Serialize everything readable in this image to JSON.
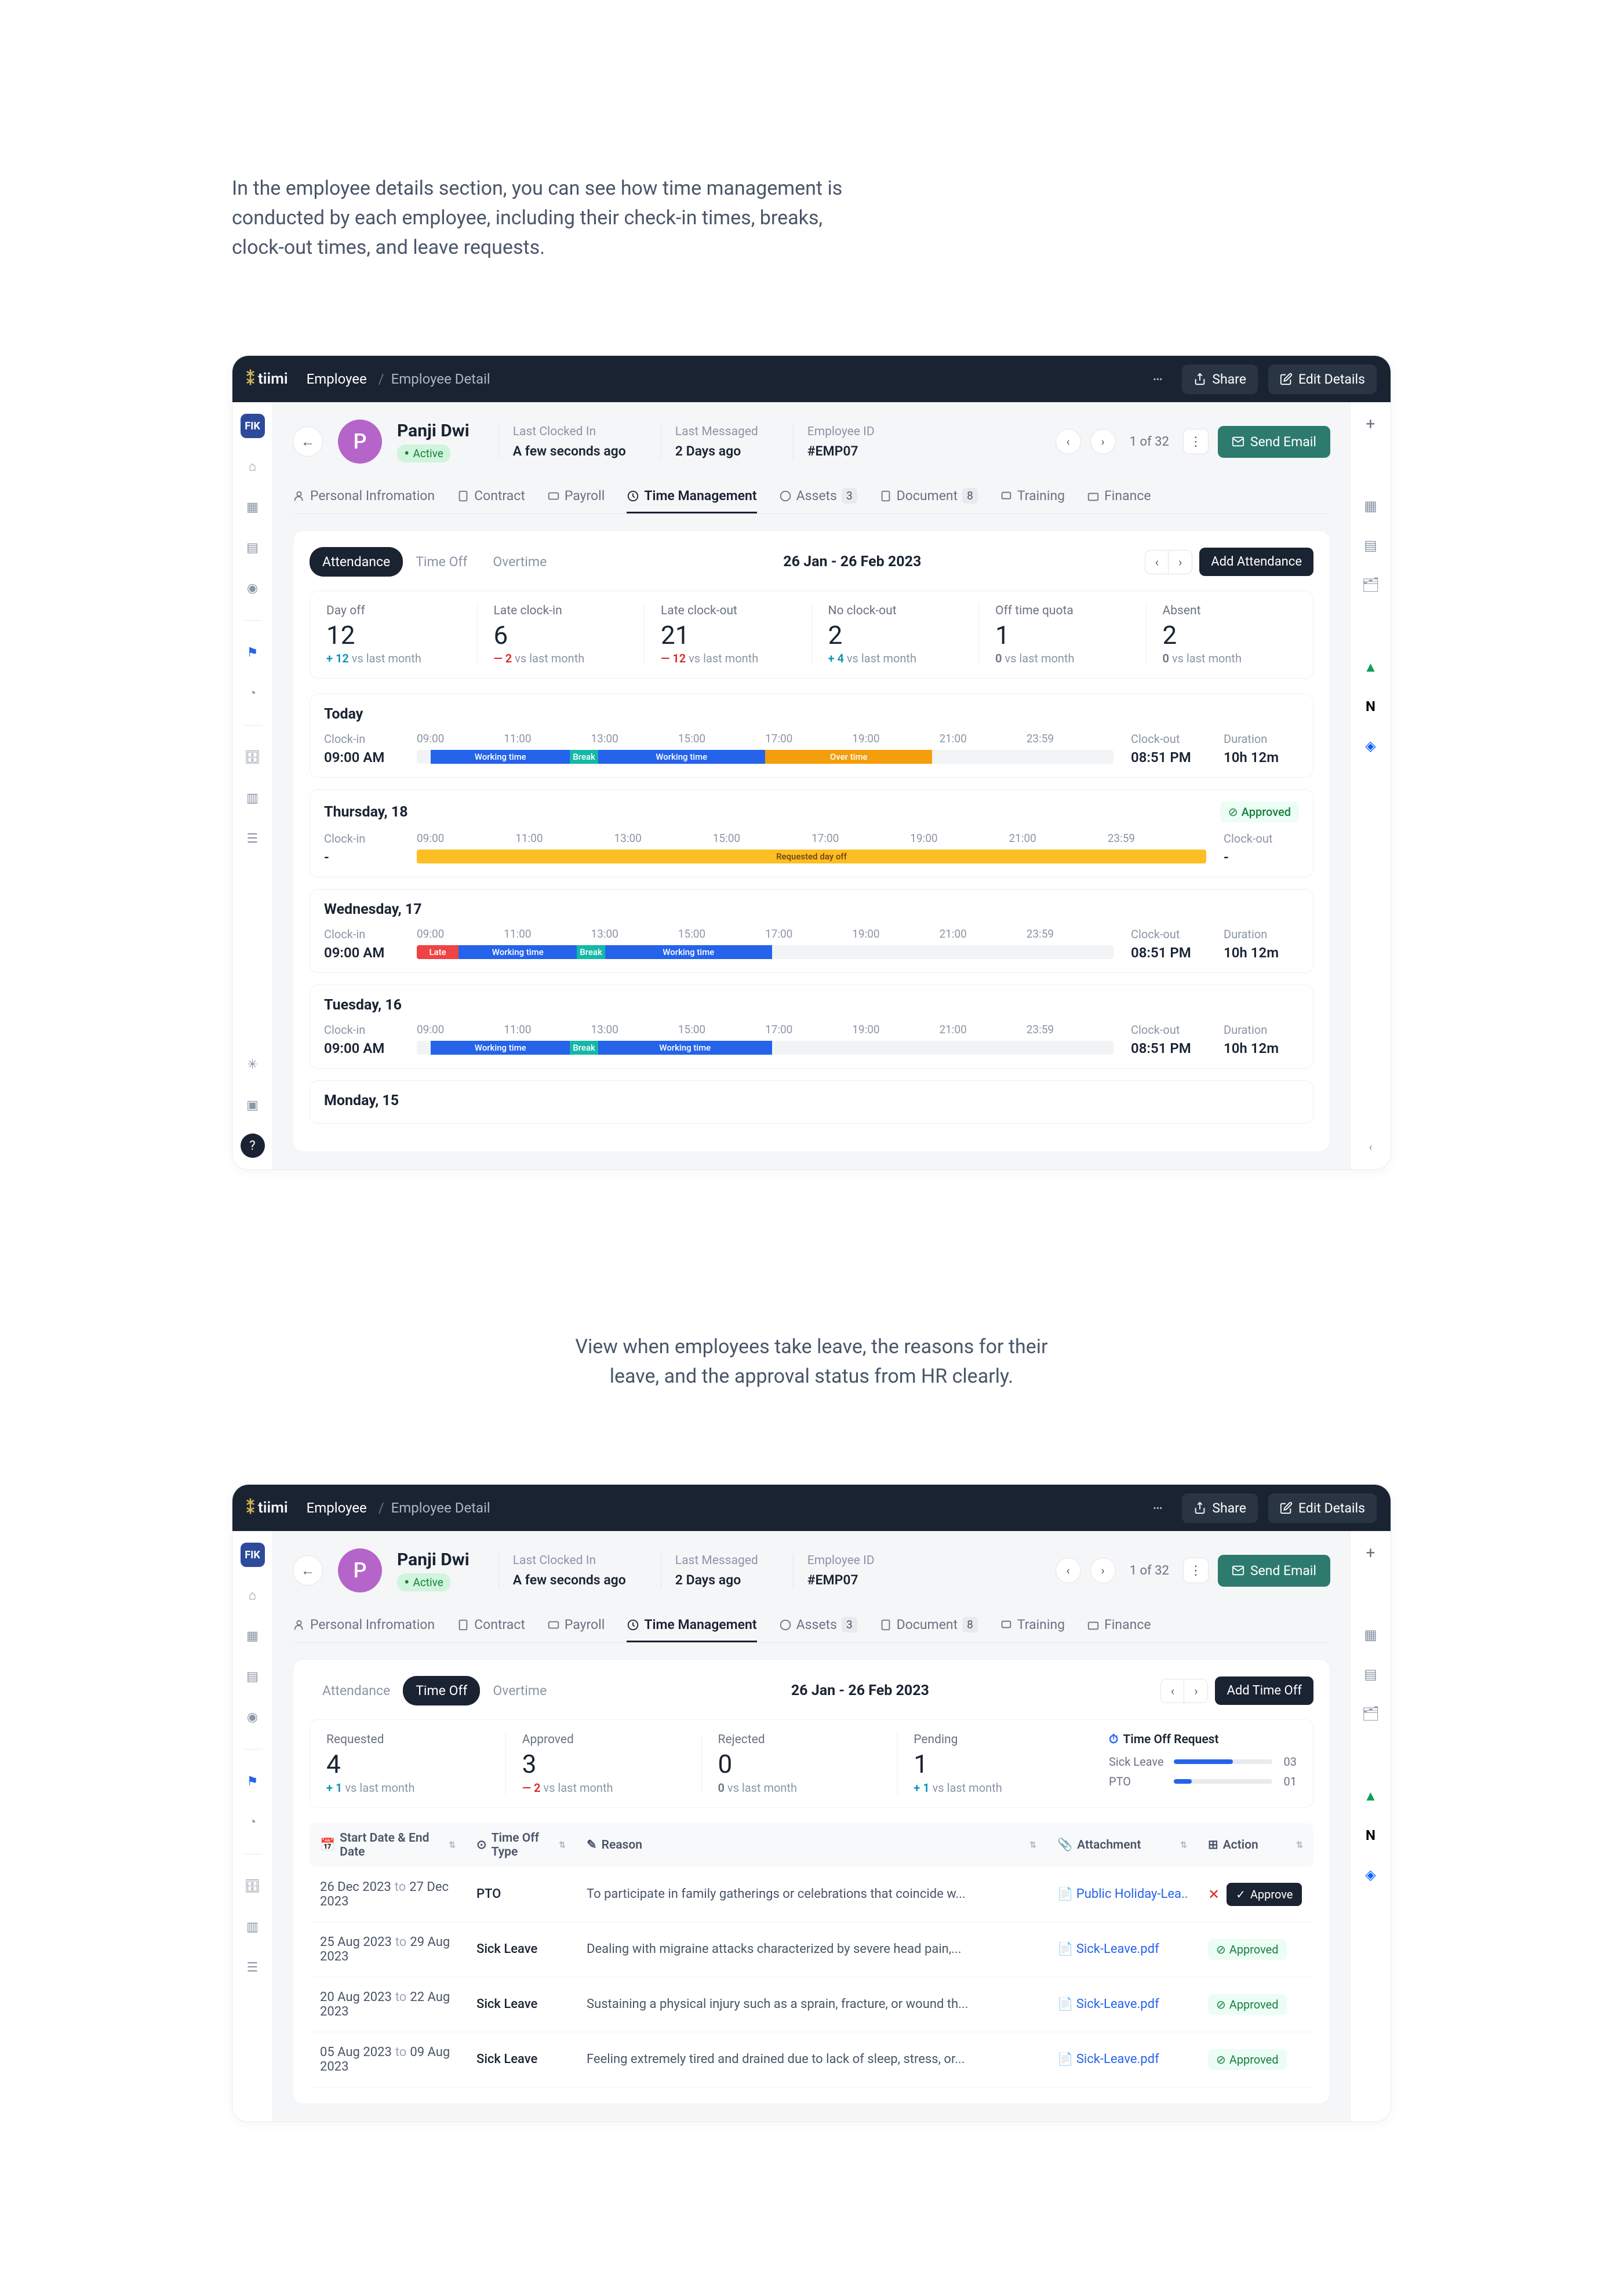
{
  "intro1": "In the employee details section, you can see how time management is conducted by each employee, including their check-in times, breaks, clock-out times, and leave requests.",
  "intro2": "View when employees take leave, the reasons for their leave, and the approval status from HR clearly.",
  "logo": "tiimi",
  "breadcrumb": {
    "a": "Employee",
    "b": "Employee Detail"
  },
  "topActions": {
    "share": "Share",
    "edit": "Edit Details"
  },
  "employee": {
    "initial": "P",
    "name": "Panji Dwi",
    "status": "Active",
    "meta": [
      {
        "label": "Last Clocked In",
        "value": "A few seconds ago"
      },
      {
        "label": "Last Messaged",
        "value": "2 Days ago"
      },
      {
        "label": "Employee ID",
        "value": "#EMP07"
      }
    ],
    "page": "1 of 32",
    "send": "Send Email"
  },
  "tabs": [
    {
      "label": "Personal Infromation"
    },
    {
      "label": "Contract"
    },
    {
      "label": "Payroll"
    },
    {
      "label": "Time Management",
      "active": true
    },
    {
      "label": "Assets",
      "count": "3"
    },
    {
      "label": "Document",
      "count": "8"
    },
    {
      "label": "Training"
    },
    {
      "label": "Finance"
    }
  ],
  "dateRange": "26 Jan - 26 Feb 2023",
  "attendance": {
    "pills": [
      "Attendance",
      "Time Off",
      "Overtime"
    ],
    "addBtn": "Add Attendance",
    "stats": [
      {
        "label": "Day off",
        "value": "12",
        "delta": "+ 12",
        "dir": "up",
        "suffix": " vs last month"
      },
      {
        "label": "Late clock-in",
        "value": "6",
        "delta": "— 2",
        "dir": "down",
        "suffix": " vs last month"
      },
      {
        "label": "Late clock-out",
        "value": "21",
        "delta": "— 12",
        "dir": "down",
        "suffix": " vs last month"
      },
      {
        "label": "No clock-out",
        "value": "2",
        "delta": "+ 4",
        "dir": "up",
        "suffix": " vs last month"
      },
      {
        "label": "Off time quota",
        "value": "1",
        "delta": "0",
        "dir": "neutral",
        "suffix": " vs last month"
      },
      {
        "label": "Absent",
        "value": "2",
        "delta": "0",
        "dir": "neutral",
        "suffix": " vs last month"
      }
    ],
    "hours": [
      "09:00",
      "11:00",
      "13:00",
      "15:00",
      "17:00",
      "19:00",
      "21:00",
      "23:59"
    ],
    "labels": {
      "clockin": "Clock-in",
      "clockout": "Clock-out",
      "duration": "Duration",
      "working": "Working time",
      "break": "Break",
      "overtime": "Over time",
      "late": "Late",
      "reqoff": "Requested day off",
      "approved": "Approved"
    },
    "days": [
      {
        "title": "Today",
        "clockin": "09:00 AM",
        "clockout": "08:51 PM",
        "duration": "10h 12m"
      },
      {
        "title": "Thursday, 18",
        "clockin": "-",
        "clockout": "-",
        "approved": true
      },
      {
        "title": "Wednesday, 17",
        "clockin": "09:00 AM",
        "clockout": "08:51 PM",
        "duration": "10h 12m"
      },
      {
        "title": "Tuesday, 16",
        "clockin": "09:00 AM",
        "clockout": "08:51 PM",
        "duration": "10h 12m"
      },
      {
        "title": "Monday, 15"
      }
    ]
  },
  "timeoff": {
    "pills": [
      "Attendance",
      "Time Off",
      "Overtime"
    ],
    "addBtn": "Add Time Off",
    "stats": [
      {
        "label": "Requested",
        "value": "4",
        "delta": "+ 1",
        "dir": "up",
        "suffix": " vs last month"
      },
      {
        "label": "Approved",
        "value": "3",
        "delta": "— 2",
        "dir": "down",
        "suffix": " vs last month"
      },
      {
        "label": "Rejected",
        "value": "0",
        "delta": "0",
        "dir": "neutral",
        "suffix": " vs last month"
      },
      {
        "label": "Pending",
        "value": "1",
        "delta": "+ 1",
        "dir": "up",
        "suffix": " vs last month"
      }
    ],
    "torTitle": "Time Off Request",
    "tor": [
      {
        "label": "Sick Leave",
        "count": "03",
        "pct": 60
      },
      {
        "label": "PTO",
        "count": "01",
        "pct": 18
      }
    ],
    "columns": {
      "date": "Start Date & End Date",
      "type": "Time Off Type",
      "reason": "Reason",
      "att": "Attachment",
      "action": "Action"
    },
    "rows": [
      {
        "start": "26 Dec 2023",
        "end": "27 Dec 2023",
        "type": "PTO",
        "reason": "To participate in family gatherings or celebrations that coincide w...",
        "att": "Public Holiday-Lea...",
        "pending": true
      },
      {
        "start": "25 Aug 2023",
        "end": "29 Aug 2023",
        "type": "Sick Leave",
        "reason": "Dealing with migraine attacks characterized by severe head pain,...",
        "att": "Sick-Leave.pdf",
        "status": "Approved"
      },
      {
        "start": "20 Aug 2023",
        "end": "22 Aug 2023",
        "type": "Sick Leave",
        "reason": "Sustaining a physical injury such as a sprain, fracture, or wound th...",
        "att": "Sick-Leave.pdf",
        "status": "Approved"
      },
      {
        "start": "05 Aug 2023",
        "end": "09 Aug 2023",
        "type": "Sick Leave",
        "reason": "Feeling extremely tired and drained due to lack of sleep, stress, or...",
        "att": "Sick-Leave.pdf",
        "status": "Approved"
      }
    ],
    "approveBtn": "Approve",
    "to": "to"
  }
}
